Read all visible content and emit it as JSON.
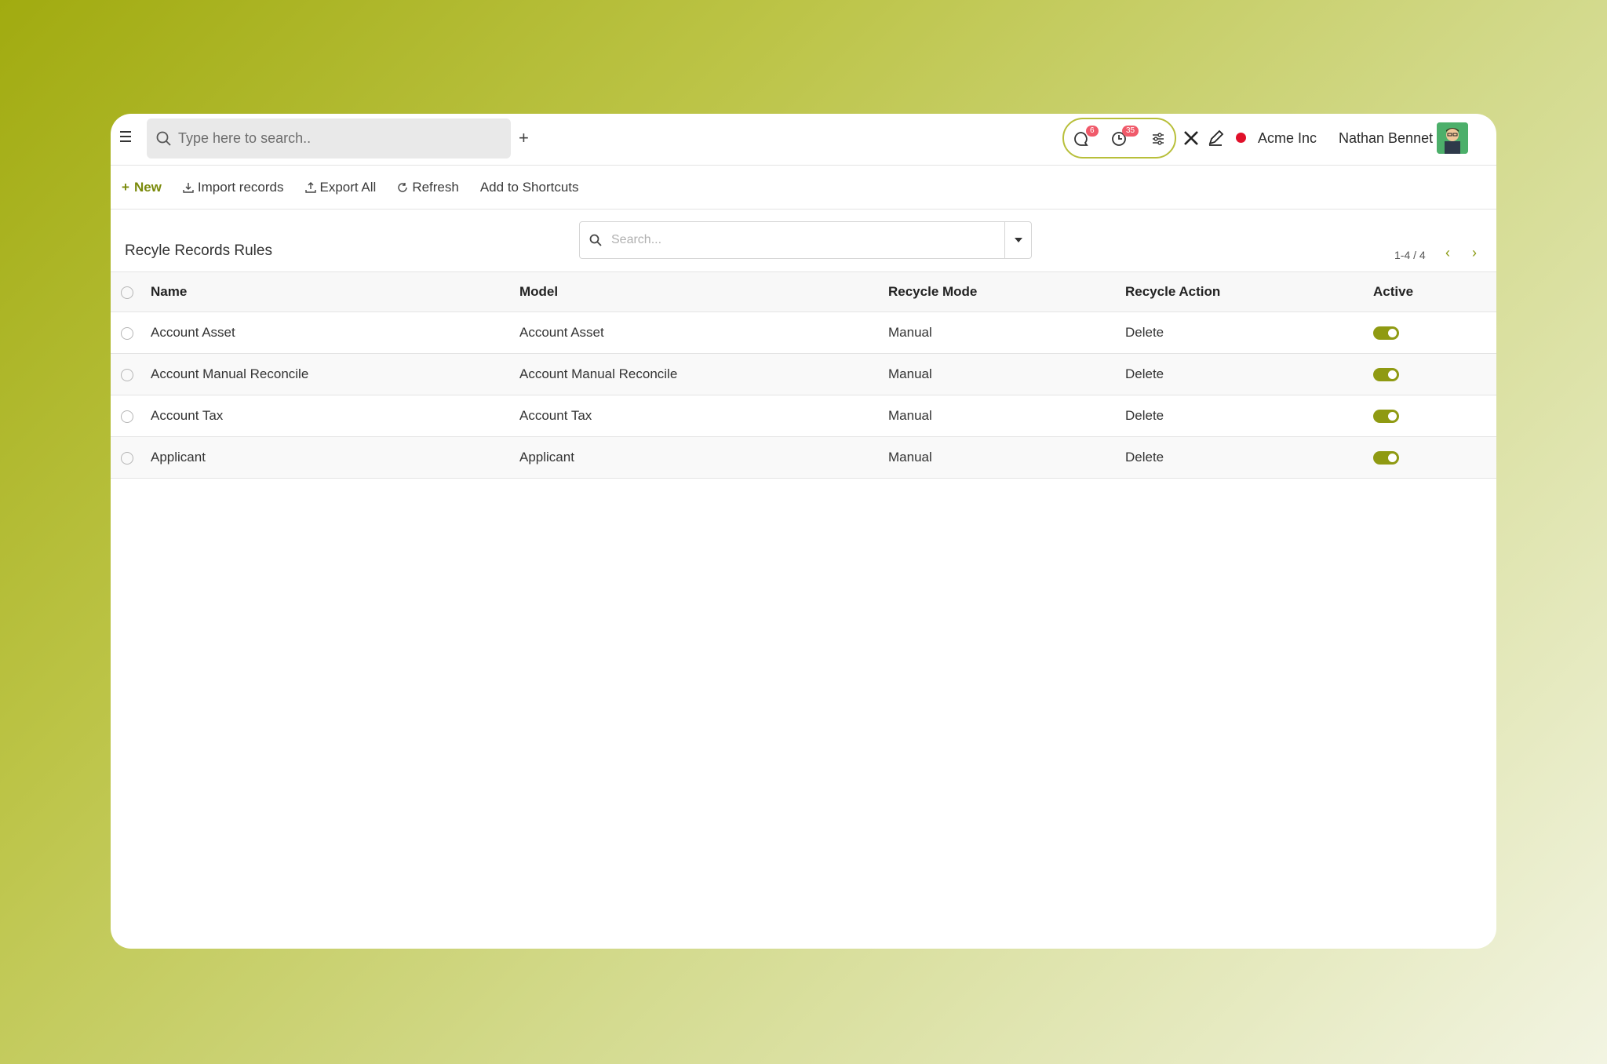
{
  "topbar": {
    "search_placeholder": "Type here to search..",
    "messages_count": "6",
    "activities_count": "35",
    "company": "Acme Inc",
    "user": "Nathan Bennet"
  },
  "actions": {
    "new": "New",
    "import": "Import records",
    "export": "Export All",
    "refresh": "Refresh",
    "shortcuts": "Add to Shortcuts"
  },
  "panel": {
    "title": "Recyle Records Rules",
    "search_placeholder": "Search...",
    "pager": "1-4 / 4"
  },
  "table": {
    "headers": {
      "name": "Name",
      "model": "Model",
      "mode": "Recycle Mode",
      "action": "Recycle Action",
      "active": "Active"
    },
    "rows": [
      {
        "name": "Account Asset",
        "model": "Account Asset",
        "mode": "Manual",
        "action": "Delete",
        "active": true
      },
      {
        "name": "Account Manual Reconcile",
        "model": "Account Manual Reconcile",
        "mode": "Manual",
        "action": "Delete",
        "active": true
      },
      {
        "name": "Account Tax",
        "model": "Account Tax",
        "mode": "Manual",
        "action": "Delete",
        "active": true
      },
      {
        "name": "Applicant",
        "model": "Applicant",
        "mode": "Manual",
        "action": "Delete",
        "active": true
      }
    ]
  },
  "colors": {
    "accent": "#8f9a12",
    "status_dot": "#e0102a",
    "badge": "#f05a6a"
  }
}
